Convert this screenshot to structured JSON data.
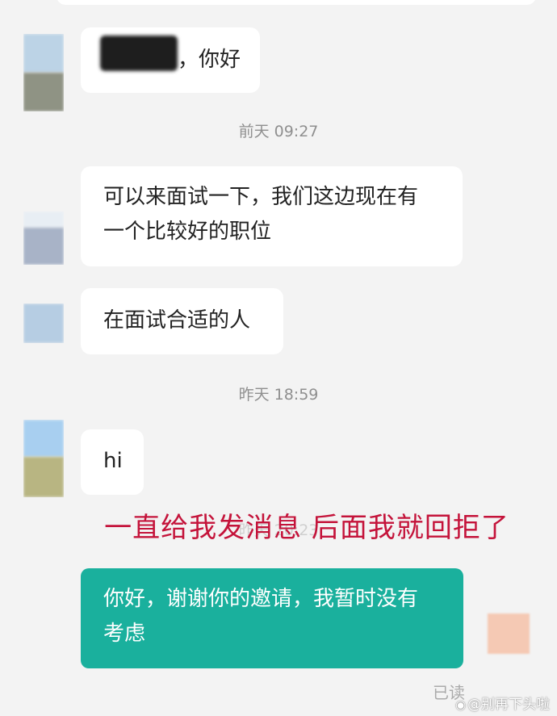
{
  "chat": {
    "messages": [
      {
        "type": "received",
        "text": "，你好",
        "has_redacted_name": true
      },
      {
        "type": "timestamp",
        "text": "前天 09:27"
      },
      {
        "type": "received",
        "lines": [
          "可以来面试一下，我们这边现在有",
          "一个比较好的职位"
        ]
      },
      {
        "type": "received",
        "text": "在面试合适的人"
      },
      {
        "type": "timestamp",
        "text": "昨天 18:59"
      },
      {
        "type": "received",
        "text": "hi"
      },
      {
        "type": "sent",
        "lines": [
          "你好，谢谢你的邀请，我暂时没有",
          "考虑"
        ]
      }
    ],
    "ghost_timestamp": "昨天 20:23",
    "read_status": "已读"
  },
  "annotation": "一直给我发消息 后面我就回拒了",
  "watermark": {
    "text": "@别再下头啦",
    "icon": "weibo-icon"
  },
  "colors": {
    "background": "#f3f3f3",
    "bubble_received": "#ffffff",
    "bubble_sent": "#1ab09d",
    "annotation": "#c4133a",
    "timestamp": "#8f8f8f"
  }
}
